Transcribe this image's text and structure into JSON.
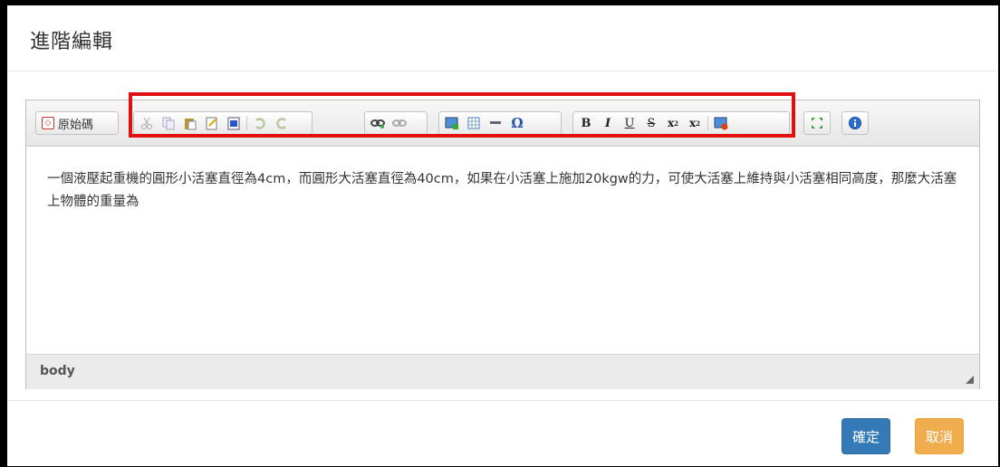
{
  "modal": {
    "title": "進階編輯"
  },
  "toolbar": {
    "source_label": "原始碼",
    "groups": [
      [
        "cut-icon",
        "copy-icon",
        "paste-icon",
        "paste-text-icon",
        "paste-word-icon",
        "undo-icon",
        "redo-icon"
      ],
      [
        "link-icon",
        "unlink-icon"
      ],
      [
        "image-icon",
        "table-icon",
        "horizontal-line-icon",
        "special-char-icon"
      ],
      [
        "bold-icon",
        "italic-icon",
        "underline-icon",
        "strike-icon",
        "subscript-icon",
        "superscript-icon",
        "flash-icon"
      ],
      [
        "maximize-icon"
      ],
      [
        "about-icon"
      ]
    ],
    "format_glyphs": {
      "bold": "B",
      "italic": "I",
      "underline": "U",
      "strike": "S",
      "subscript": "X",
      "superscript": "X",
      "special": "Ω"
    }
  },
  "editor": {
    "content": "一個液壓起重機的圓形小活塞直徑為4cm，而圓形大活塞直徑為40cm，如果在小活塞上施加20kgw的力，可使大活塞上維持與小活塞相同高度，那麼大活塞上物體的重量為",
    "status_path": "body"
  },
  "footer": {
    "ok_label": "確定",
    "cancel_label": "取消"
  },
  "colors": {
    "primary": "#337ab7",
    "warning": "#f0ad4e",
    "highlight": "#e01010"
  }
}
